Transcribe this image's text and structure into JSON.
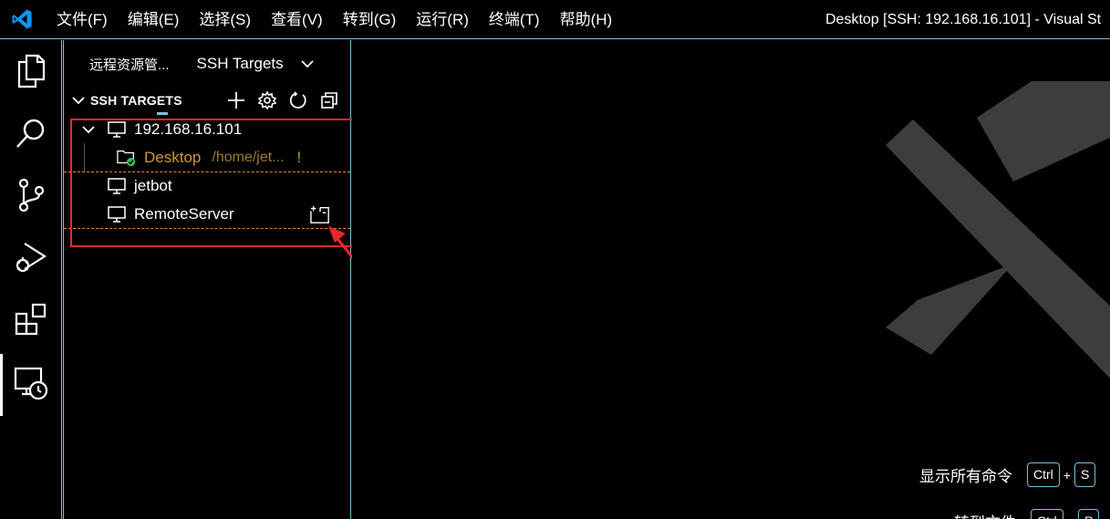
{
  "titlebar": {
    "menu": [
      "文件(F)",
      "编辑(E)",
      "选择(S)",
      "查看(V)",
      "转到(G)",
      "运行(R)",
      "终端(T)",
      "帮助(H)"
    ],
    "window_title": "Desktop [SSH: 192.168.16.101] - Visual St"
  },
  "activitybar": {
    "items": [
      "explorer-icon",
      "search-icon",
      "source-control-icon",
      "run-debug-icon",
      "extensions-icon",
      "remote-explorer-icon"
    ]
  },
  "sidebar": {
    "title": "远程资源管...",
    "dropdown_label": "SSH Targets",
    "section_title": "SSH TARGETS",
    "actions": [
      "add-icon",
      "gear-icon",
      "refresh-icon",
      "collapse-all-icon"
    ],
    "hosts": [
      {
        "label": "192.168.16.101",
        "expanded": true
      },
      {
        "label": "jetbot"
      },
      {
        "label": "RemoteServer"
      }
    ],
    "folder": {
      "label": "Desktop",
      "path": "/home/jet...",
      "warning": "!"
    }
  },
  "editor": {
    "shortcuts": [
      {
        "label": "显示所有命令",
        "keys": [
          "Ctrl",
          "S"
        ]
      },
      {
        "label": "转到文件",
        "keys": [
          "Ctrl",
          "P"
        ]
      }
    ]
  },
  "colors": {
    "accent": "#6fc3df",
    "highlight": "#e8282c",
    "folder": "#c89b34",
    "vscode_blue": "#0098ff",
    "success": "#3fb950"
  }
}
